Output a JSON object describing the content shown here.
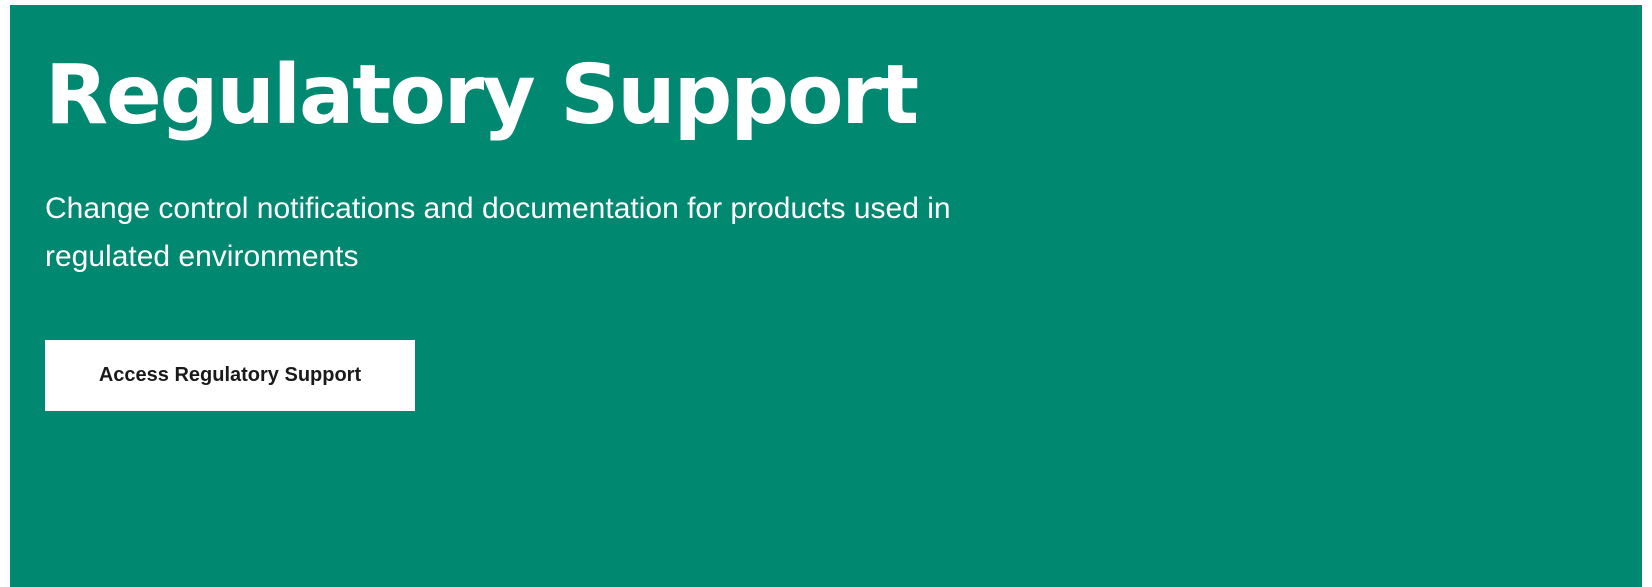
{
  "colors": {
    "hero_background": "#008870",
    "text_on_hero": "#ffffff",
    "button_background": "#ffffff",
    "button_text": "#1a1a1a"
  },
  "hero": {
    "title": "Regulatory Support",
    "subtitle": "Change control notifications and documentation for products used in regulated environments",
    "button_label": "Access Regulatory Support"
  }
}
